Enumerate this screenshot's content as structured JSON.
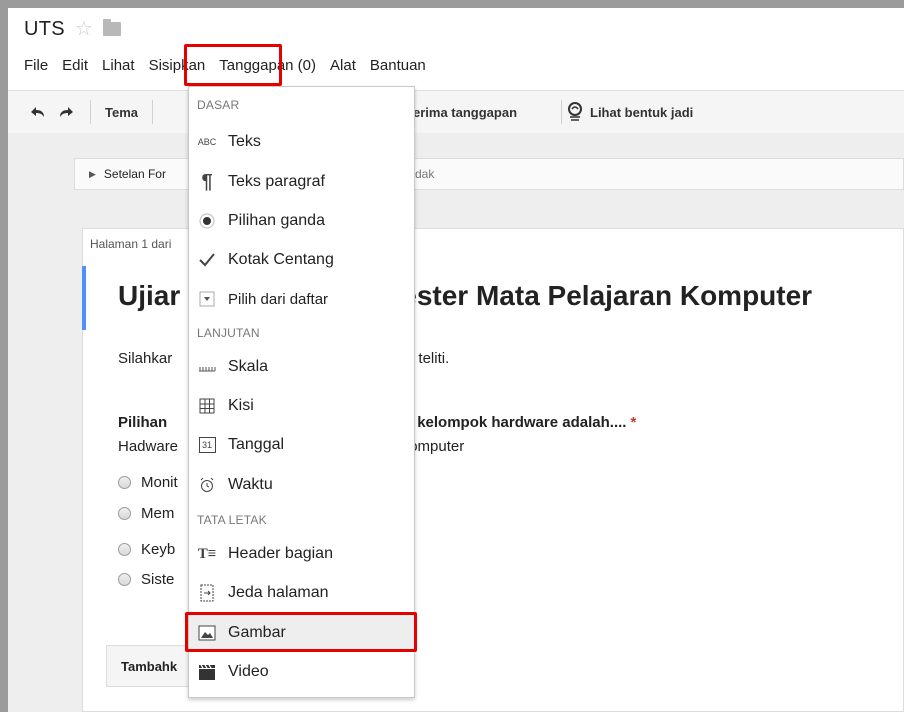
{
  "window": {
    "title": "UTS"
  },
  "menubar": {
    "items": [
      "File",
      "Edit",
      "Lihat",
      "Sisipkan",
      "Tanggapan (0)",
      "Alat",
      "Bantuan"
    ]
  },
  "toolbar": {
    "theme_label": "Tema",
    "accept_responses_label": "erima tanggapan",
    "view_live_label": "Lihat bentuk jadi"
  },
  "form": {
    "settings_label": "Setelan For",
    "settings_extra": "dak",
    "page_label": "Halaman 1 dari",
    "title_left": "Ujiar",
    "title_right": "ester Mata Pelajaran Komputer",
    "desc_left": "Silahkar",
    "desc_right": "dan teliti.",
    "question_left": "Pilihan",
    "question_right": "suk kelompok hardware adalah....",
    "required_mark": "*",
    "help_left": "Hadware",
    "help_right": "s komputer",
    "options": [
      "Monit",
      "Mem",
      "Keyb",
      "Siste"
    ],
    "add_item_label": "Tambahk"
  },
  "dropdown": {
    "sections": [
      "DASAR",
      "LANJUTAN",
      "TATA LETAK"
    ],
    "items": [
      {
        "label": "Teks",
        "icon": "abc-text-icon"
      },
      {
        "label": "Teks paragraf",
        "icon": "paragraph-icon"
      },
      {
        "label": "Pilihan ganda",
        "icon": "radio-icon"
      },
      {
        "label": "Kotak Centang",
        "icon": "checkmark-icon"
      },
      {
        "label": "Pilih dari daftar",
        "icon": "list-dropdown-icon"
      },
      {
        "label": "Skala",
        "icon": "scale-icon"
      },
      {
        "label": "Kisi",
        "icon": "grid-icon"
      },
      {
        "label": "Tanggal",
        "icon": "calendar-icon"
      },
      {
        "label": "Waktu",
        "icon": "clock-icon"
      },
      {
        "label": "Header bagian",
        "icon": "section-header-icon"
      },
      {
        "label": "Jeda halaman",
        "icon": "page-break-icon"
      },
      {
        "label": "Gambar",
        "icon": "image-icon"
      },
      {
        "label": "Video",
        "icon": "video-icon"
      }
    ],
    "abc_glyph": "ABC",
    "calendar_glyph": "31"
  },
  "colors": {
    "highlight_red": "#e60000",
    "accent_blue": "#4d90fe",
    "required_red": "#c53929"
  }
}
